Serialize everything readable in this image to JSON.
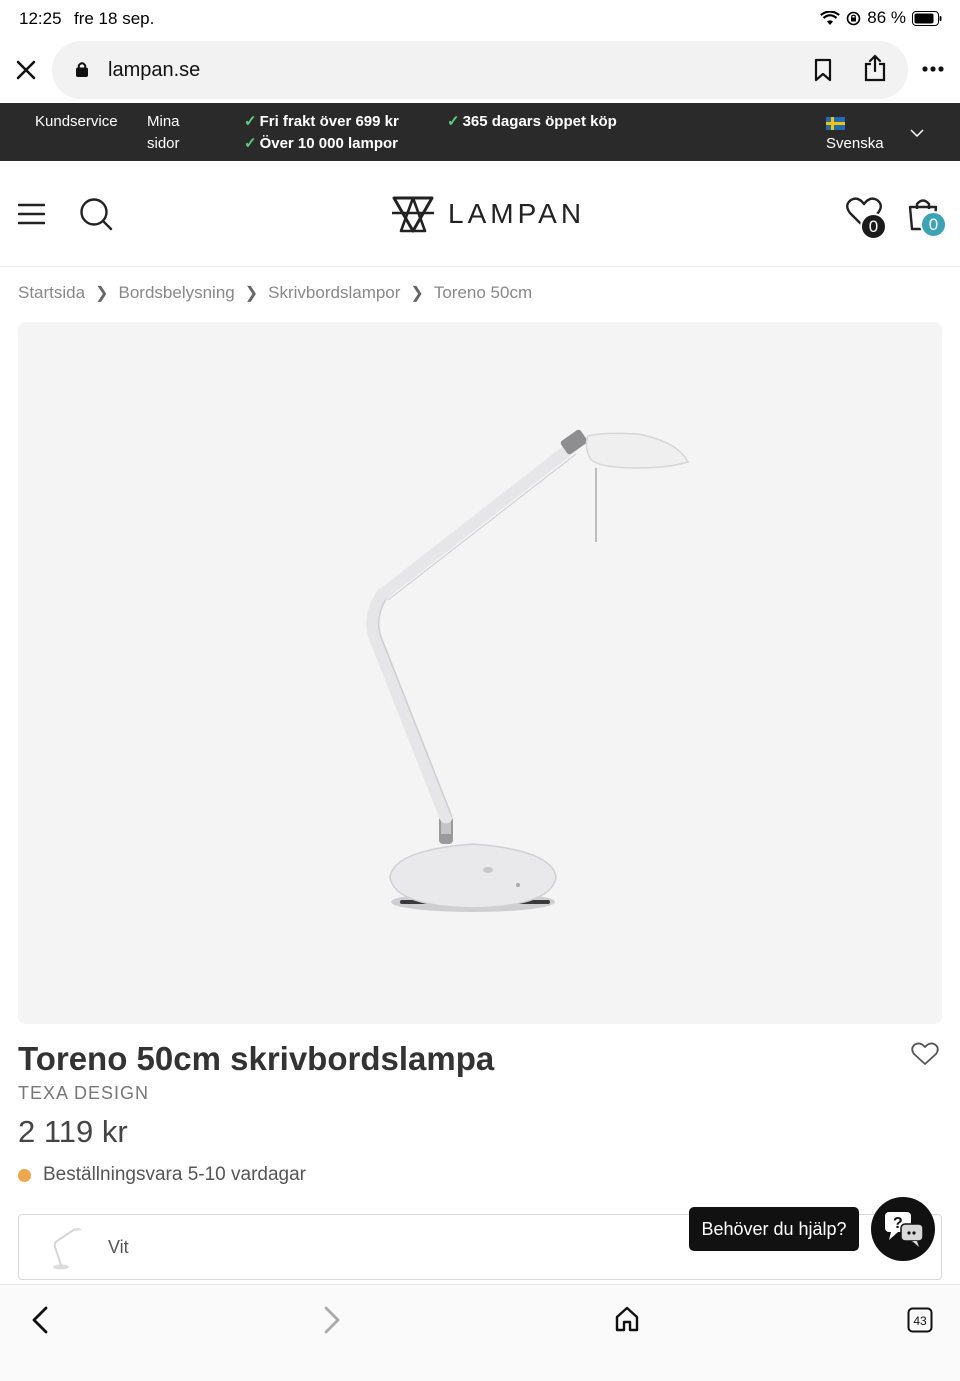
{
  "status_bar": {
    "time": "12:25",
    "date": "fre 18 sep.",
    "battery": "86 %"
  },
  "browser": {
    "url": "lampan.se",
    "tabs_count": "43"
  },
  "promo_bar": {
    "customer_service": "Kundservice",
    "my_pages_line1": "Mina",
    "my_pages_line2": "sidor",
    "free_shipping": "Fri frakt över 699 kr",
    "lamps_count": "Över 10 000 lampor",
    "open_purchase": "365 dagars öppet köp",
    "language": "Svenska"
  },
  "header": {
    "logo_text": "LAMPAN",
    "wishlist_count": "0",
    "cart_count": "0"
  },
  "breadcrumb": [
    "Startsida",
    "Bordsbelysning",
    "Skrivbordslampor",
    "Toreno 50cm"
  ],
  "product": {
    "title": "Toreno 50cm skrivbordslampa",
    "brand": "TEXA DESIGN",
    "price": "2 119 kr",
    "stock_status": "Beställningsvara 5-10 vardagar",
    "variant_label": "Vit"
  },
  "help": {
    "label": "Behöver du hjälp?"
  },
  "colors": {
    "promo_bg": "#2a2a2a",
    "check_green": "#5fd07c",
    "cart_badge": "#3aa3b8",
    "stock_dot": "#f0a64a"
  }
}
